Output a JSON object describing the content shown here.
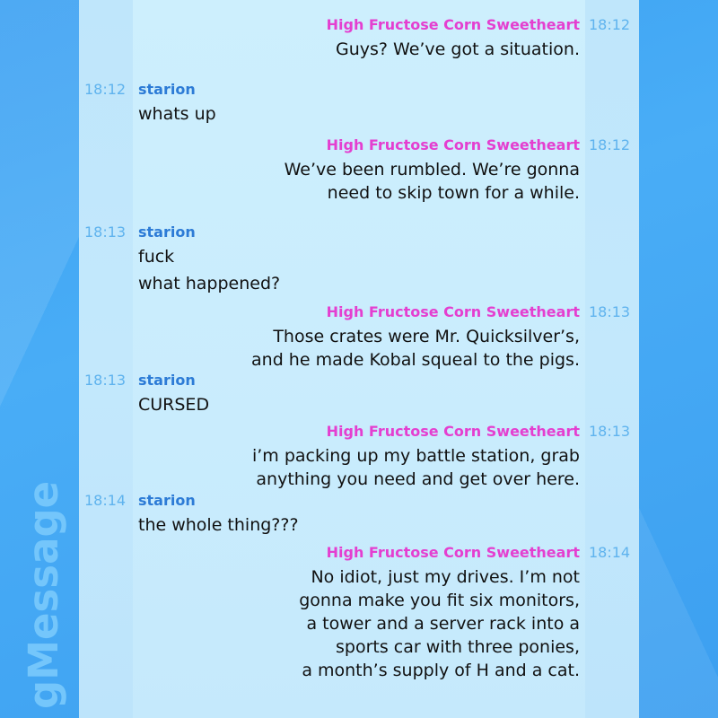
{
  "app": {
    "watermark": "gMessage"
  },
  "participants": {
    "hfcs": "High Fructose Corn Sweetheart",
    "starion": "starion"
  },
  "colors": {
    "hfcs": "#e43fd0",
    "starion": "#2c7bd6",
    "time": "#5fb3ee"
  },
  "messages": [
    {
      "time": "18:12",
      "lines": [
        "Guys? We’ve got a situation."
      ]
    },
    {
      "time": "18:12",
      "lines": [
        "whats up"
      ]
    },
    {
      "time": "18:12",
      "lines": [
        "We’ve been rumbled. We’re gonna",
        "need to skip town for a while."
      ]
    },
    {
      "time": "18:13",
      "lines": [
        "fuck",
        "what happened?"
      ]
    },
    {
      "time": "18:13",
      "lines": [
        "Those crates were Mr. Quicksilver’s,",
        "and he made Kobal squeal to the pigs."
      ]
    },
    {
      "time": "18:13",
      "lines": [
        "CURSED"
      ]
    },
    {
      "time": "18:13",
      "lines": [
        "i’m packing up my battle station, grab",
        "anything you need and get over here."
      ]
    },
    {
      "time": "18:14",
      "lines": [
        "the whole thing???"
      ]
    },
    {
      "time": "18:14",
      "lines": [
        "No idiot, just my drives. I’m not",
        "gonna make you fit six monitors,",
        "a tower and a server rack into a",
        "sports car with three ponies,",
        "a month’s supply of H and a cat."
      ]
    }
  ]
}
